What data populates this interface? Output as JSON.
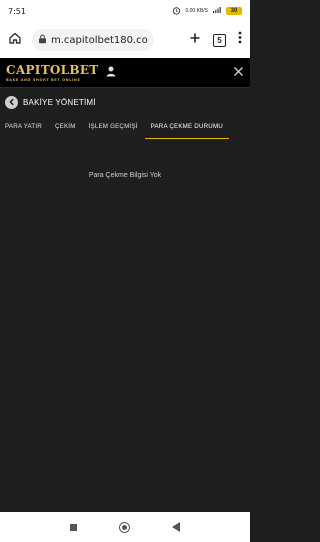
{
  "statusbar": {
    "time": "7:51",
    "small_text": "0.00 KB/S",
    "battery": "30"
  },
  "browser": {
    "url": "m.capitolbet180.com",
    "tab_count": "5"
  },
  "header": {
    "logo_main": "CAPITOLBET",
    "logo_tagline": "BAKE AND SHORT BET ONLINE"
  },
  "section": {
    "title": "BAKİYE YÖNETİMİ"
  },
  "tabs": [
    {
      "label": "PARA YATIR"
    },
    {
      "label": "ÇEKİM"
    },
    {
      "label": "İŞLEM GEÇMİŞİ"
    },
    {
      "label": "PARA ÇEKME DURUMU"
    }
  ],
  "content": {
    "empty_message": "Para Çekme Bilgisi Yok"
  },
  "colors": {
    "accent": "#e6b800",
    "background": "#1e1e1e",
    "header": "#000000"
  }
}
